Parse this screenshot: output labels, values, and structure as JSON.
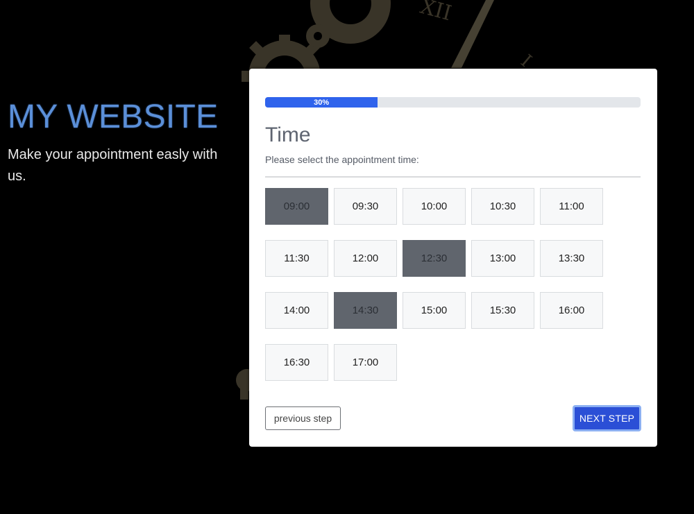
{
  "hero": {
    "title": "MY WEBSITE",
    "tagline": "Make your appointment easly with us."
  },
  "progress": {
    "percent": 30,
    "label": "30%"
  },
  "step": {
    "title": "Time",
    "subtitle": "Please select the appointment time:"
  },
  "time_slots": [
    {
      "label": "09:00",
      "available": false
    },
    {
      "label": "09:30",
      "available": true
    },
    {
      "label": "10:00",
      "available": true
    },
    {
      "label": "10:30",
      "available": true
    },
    {
      "label": "11:00",
      "available": true
    },
    {
      "label": "11:30",
      "available": true
    },
    {
      "label": "12:00",
      "available": true
    },
    {
      "label": "12:30",
      "available": false
    },
    {
      "label": "13:00",
      "available": true
    },
    {
      "label": "13:30",
      "available": true
    },
    {
      "label": "14:00",
      "available": true
    },
    {
      "label": "14:30",
      "available": false
    },
    {
      "label": "15:00",
      "available": true
    },
    {
      "label": "15:30",
      "available": true
    },
    {
      "label": "16:00",
      "available": true
    },
    {
      "label": "16:30",
      "available": true
    },
    {
      "label": "17:00",
      "available": true
    }
  ],
  "buttons": {
    "previous": "previous step",
    "next": "NEXT STEP"
  },
  "colors": {
    "title": "#5b8fd8",
    "progress": "#2f63ec",
    "next_button": "#2b4fd6",
    "unavailable_slot": "#60656d"
  }
}
